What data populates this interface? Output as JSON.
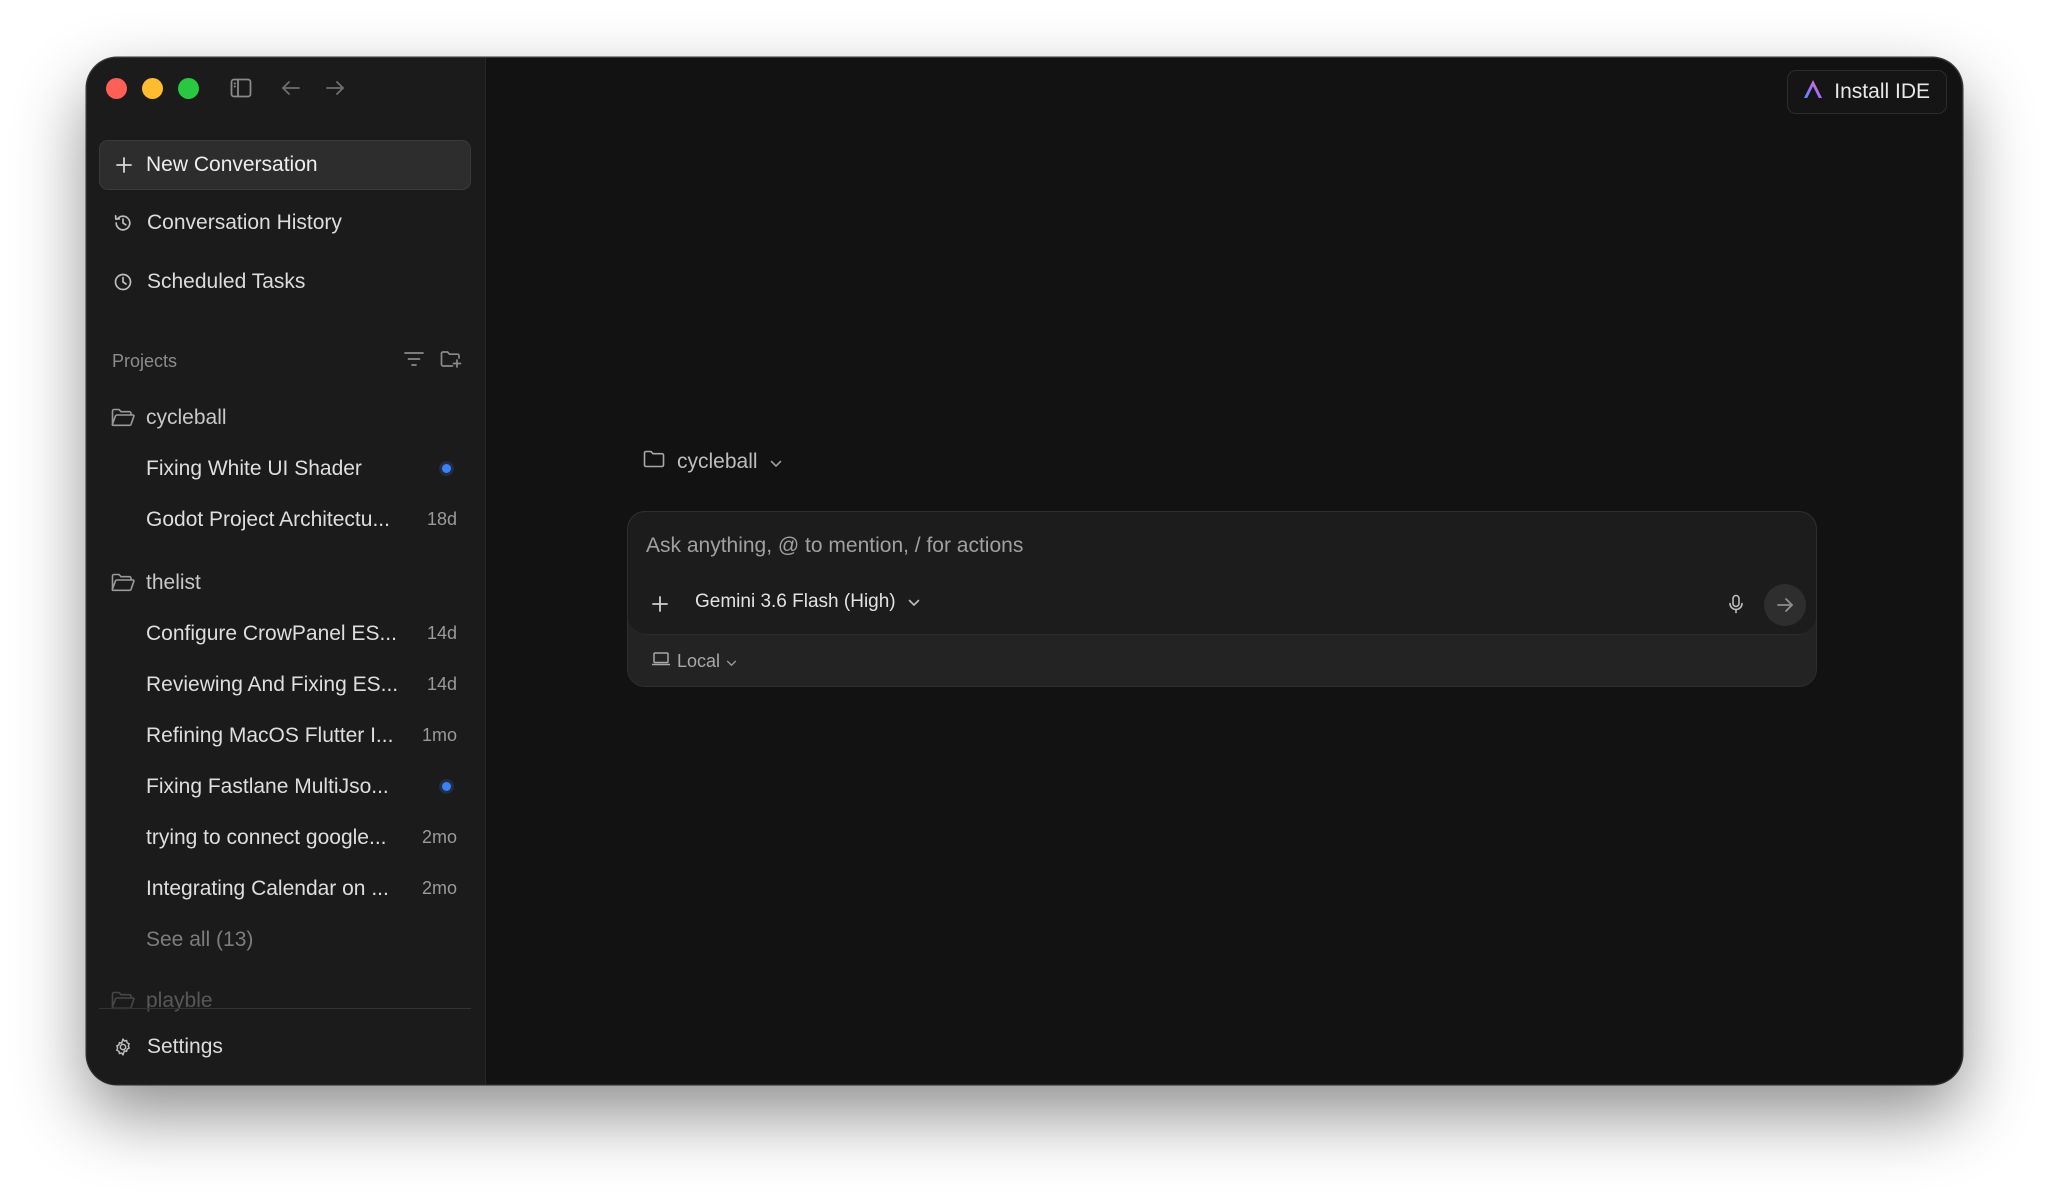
{
  "sidebar": {
    "new_conversation": "New Conversation",
    "conversation_history": "Conversation History",
    "scheduled_tasks": "Scheduled Tasks",
    "projects_label": "Projects",
    "settings": "Settings",
    "projects": [
      {
        "name": "cycleball",
        "conversations": [
          {
            "title": "Fixing White UI Shader",
            "age": "",
            "unread": true
          },
          {
            "title": "Godot Project Architectu...",
            "age": "18d",
            "unread": false
          }
        ]
      },
      {
        "name": "thelist",
        "conversations": [
          {
            "title": "Configure CrowPanel ES...",
            "age": "14d",
            "unread": false
          },
          {
            "title": "Reviewing And Fixing ES...",
            "age": "14d",
            "unread": false
          },
          {
            "title": "Refining MacOS Flutter I...",
            "age": "1mo",
            "unread": false
          },
          {
            "title": "Fixing Fastlane MultiJso...",
            "age": "",
            "unread": true
          },
          {
            "title": "trying to connect google...",
            "age": "2mo",
            "unread": false
          },
          {
            "title": "Integrating Calendar on ...",
            "age": "2mo",
            "unread": false
          }
        ],
        "see_all": "See all (13)"
      },
      {
        "name": "playble",
        "conversations": []
      }
    ]
  },
  "header": {
    "install_ide": "Install IDE"
  },
  "composer": {
    "project": "cycleball",
    "placeholder": "Ask anything, @ to mention, / for actions",
    "model": "Gemini 3.6 Flash (High)",
    "environment": "Local"
  },
  "colors": {
    "window_bg": "#121212",
    "sidebar_bg": "#1b1b1b",
    "unread_dot": "#3b82f6",
    "traffic_close": "#ff5f57",
    "traffic_min": "#febc2e",
    "traffic_max": "#28c840"
  }
}
